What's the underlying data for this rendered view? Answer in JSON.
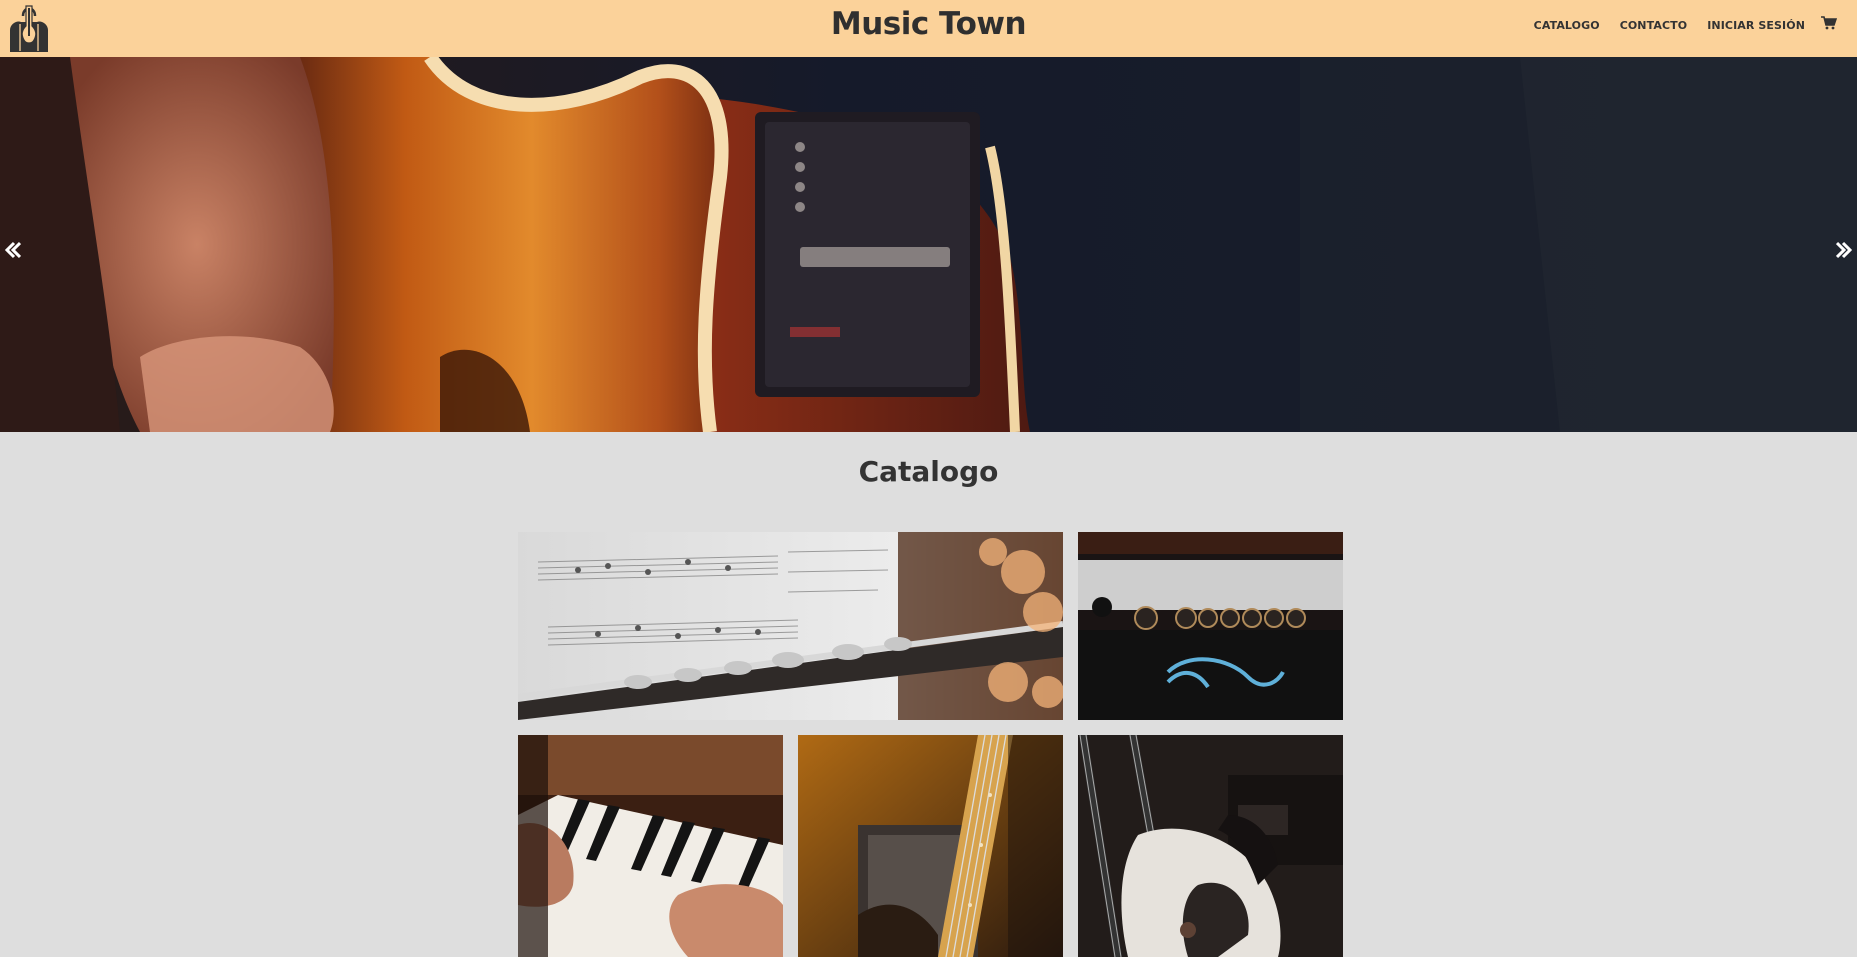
{
  "navbar": {
    "brand": "Music Town",
    "logo_icon": "guitar-bag-logo-icon",
    "links": [
      "CATALOGO",
      "CONTACTO",
      "INICIAR SESIÓN"
    ],
    "cart_icon": "shopping-cart-icon",
    "background": "#fbd29a"
  },
  "hero": {
    "prev_icon": "chevron-left-icon",
    "next_icon": "chevron-right-icon"
  },
  "catalog": {
    "title": "Catalogo",
    "background": "#dedede"
  }
}
